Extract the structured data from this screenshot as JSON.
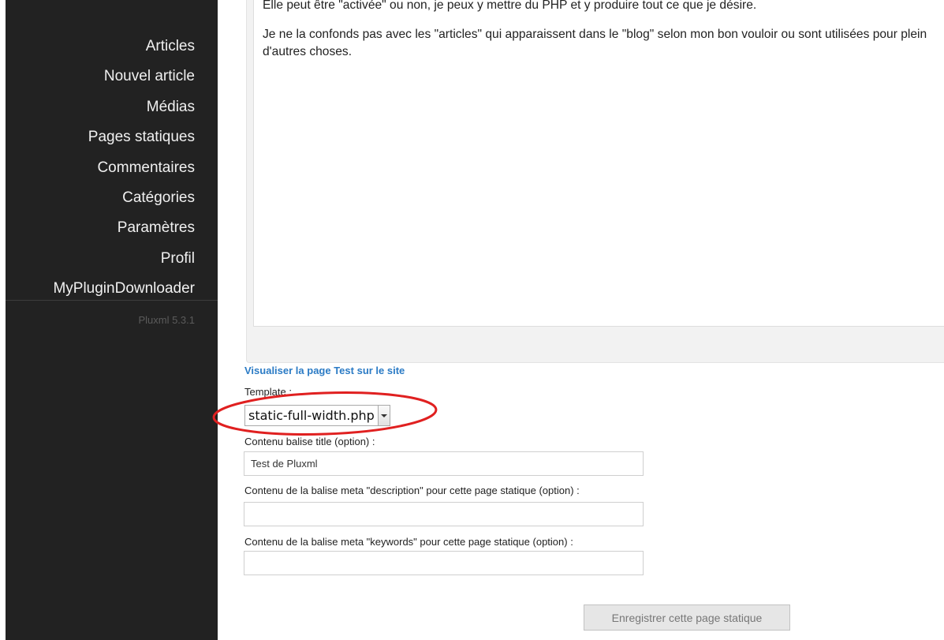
{
  "sidebar": {
    "items": [
      {
        "label": "Articles"
      },
      {
        "label": "Nouvel article"
      },
      {
        "label": "Médias"
      },
      {
        "label": "Pages statiques"
      },
      {
        "label": "Commentaires"
      },
      {
        "label": "Catégories"
      },
      {
        "label": "Paramètres"
      },
      {
        "label": "Profil"
      },
      {
        "label": "MyPluginDownloader"
      }
    ],
    "version": "Pluxml 5.3.1"
  },
  "editor": {
    "paragraph_1": "Elle peut être \"activée\" ou non, je peux y mettre du PHP et y produire tout ce que je désire.",
    "paragraph_2": "Je ne la confonds pas avec les \"articles\" qui apparaissent dans le \"blog\" selon mon bon vouloir ou sont utilisées pour plein d'autres choses."
  },
  "form": {
    "preview_link": "Visualiser la page Test sur le site",
    "template_label": "Template :",
    "template_value": "static-full-width.php",
    "title_label": "Contenu balise title (option) :",
    "title_value": "Test de Pluxml",
    "description_label": "Contenu de la balise meta \"description\" pour cette page statique (option) :",
    "description_value": "",
    "keywords_label": "Contenu de la balise meta \"keywords\" pour cette page statique (option) :",
    "keywords_value": "",
    "save_label": "Enregistrer cette page statique"
  },
  "colors": {
    "sidebar_bg": "#222222",
    "link": "#2b7bc5",
    "annotation": "#e02020"
  }
}
